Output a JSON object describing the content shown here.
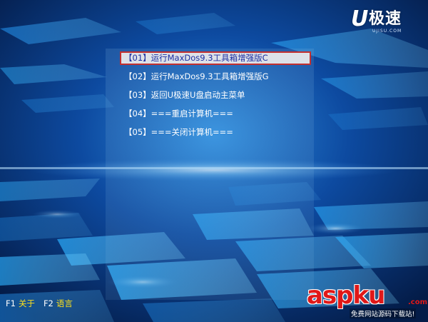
{
  "logo": {
    "letter": "U",
    "name": "极速",
    "url": "UJISU.COM"
  },
  "menu": {
    "items": [
      {
        "label": "【01】运行MaxDos9.3工具箱增强版C",
        "selected": true
      },
      {
        "label": "【02】运行MaxDos9.3工具箱增强版G",
        "selected": false
      },
      {
        "label": "【03】返回U极速U盘启动主菜单",
        "selected": false
      },
      {
        "label": "【04】===重启计算机===",
        "selected": false
      },
      {
        "label": "【05】===关闭计算机===",
        "selected": false
      }
    ]
  },
  "footer": {
    "f1_key": "F1",
    "f1_label": "关于",
    "f2_key": "F2",
    "f2_label": "语言"
  },
  "watermark": {
    "text": "aspku",
    "com": ".com",
    "subtitle": "免费网站源码下载站!"
  },
  "colors": {
    "selected_bg": "#dde1e8",
    "selected_border": "#c23030",
    "selected_text": "#1c2ea3",
    "menu_text": "#ffffff",
    "footer_key": "#ffffff",
    "footer_label": "#ffe21a",
    "background": "#062b66"
  }
}
